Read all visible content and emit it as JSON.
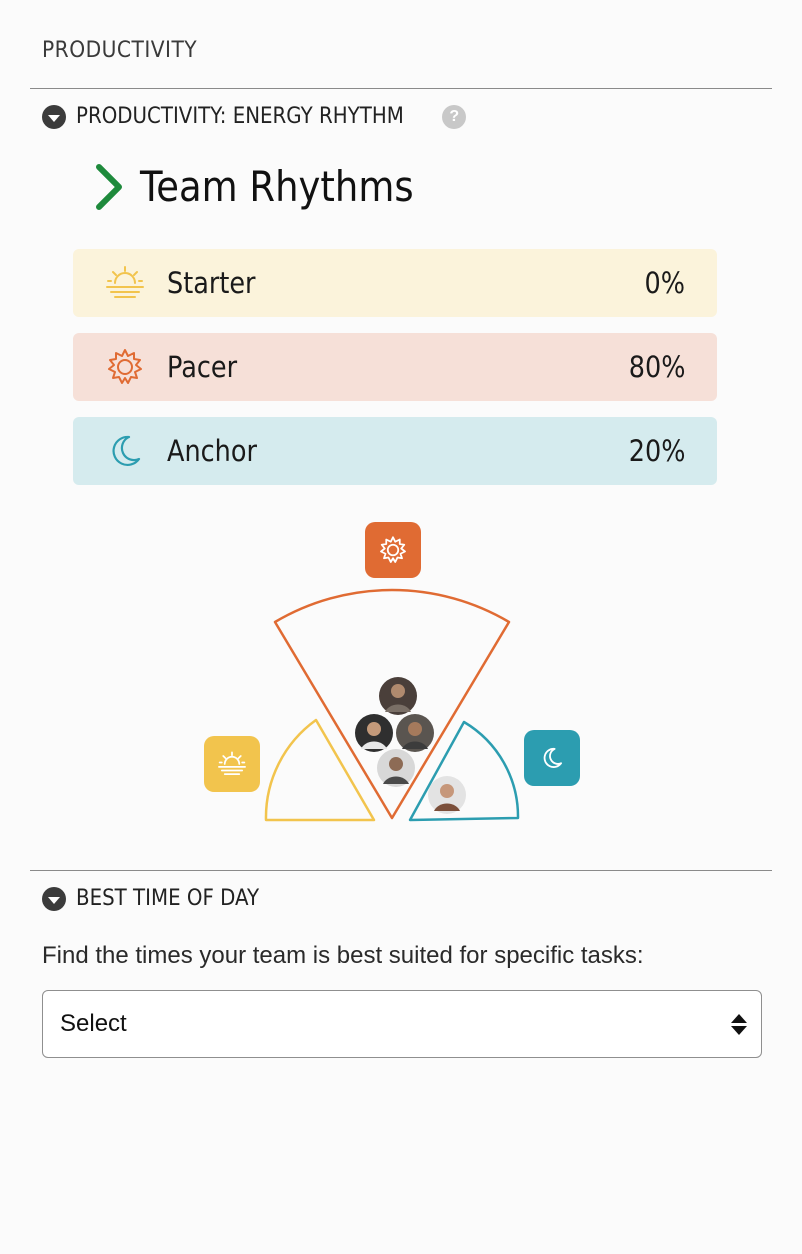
{
  "page_header": "PRODUCTIVITY",
  "energy_section": {
    "title": "PRODUCTIVITY: ENERGY RHYTHM",
    "help_glyph": "?",
    "team_title": "Team Rhythms",
    "rhythms": [
      {
        "label": "Starter",
        "percent": "0%",
        "icon": "sunrise-icon",
        "color": "#f2c44d",
        "bg": "#fbf3db"
      },
      {
        "label": "Pacer",
        "percent": "80%",
        "icon": "sun-gear-icon",
        "color": "#e06b33",
        "bg": "#f6e0d8"
      },
      {
        "label": "Anchor",
        "percent": "20%",
        "icon": "moon-icon",
        "color": "#2c9db0",
        "bg": "#d5ebee"
      }
    ]
  },
  "visualization": {
    "share": {
      "starter": 0,
      "pacer": 0.8,
      "anchor": 0.2
    },
    "team_member_avatars": [
      "avatar-1",
      "avatar-2",
      "avatar-3",
      "avatar-4",
      "avatar-5"
    ]
  },
  "best_time_section": {
    "title": "BEST TIME OF DAY",
    "intro": "Find the times your team is best suited for specific tasks:",
    "select_value": "Select"
  },
  "colors": {
    "accent_green": "#1e8a3c",
    "starter": "#f2c44d",
    "pacer": "#e06b33",
    "anchor": "#2c9db0"
  }
}
